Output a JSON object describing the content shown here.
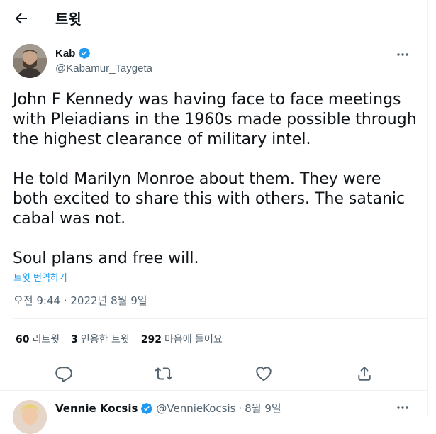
{
  "header": {
    "title": "트윗",
    "back_icon": "arrow-left-icon"
  },
  "tweet": {
    "author": {
      "name": "Kab",
      "handle": "@Kabamur_Taygeta",
      "verified": true
    },
    "text": "John F Kennedy was having face to face meetings with Pleiadians in the 1960s made possible through the highest clearance of military intel.\n\nHe told Marilyn Monroe about them. They were both excited to share this with others. The satanic cabal was not.\n\nSoul plans and free will.",
    "translate_label": "트윗 번역하기",
    "timestamp": "오전 9:44 · 2022년 8월 9일",
    "stats": [
      {
        "count": "60",
        "label": "리트윗"
      },
      {
        "count": "3",
        "label": "인용한 트윗"
      },
      {
        "count": "292",
        "label": "마음에 들어요"
      }
    ]
  },
  "reply": {
    "name": "Vennie Kocsis",
    "handle": "@VennieKocsis",
    "separator": "·",
    "date": "8월 9일",
    "verified": true
  },
  "colors": {
    "accent": "#1d9bf0",
    "text": "#0f1419",
    "muted": "#536471",
    "border": "#eff3f4"
  }
}
